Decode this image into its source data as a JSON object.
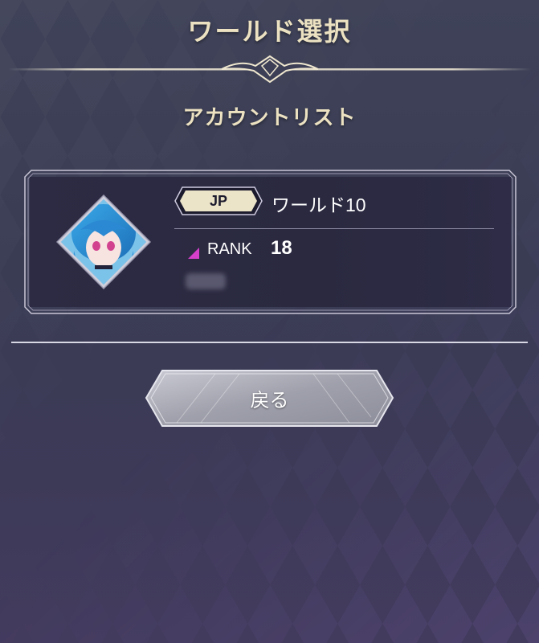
{
  "header": {
    "title": "ワールド選択",
    "subtitle": "アカウントリスト"
  },
  "account_card": {
    "region": "JP",
    "world_name": "ワールド10",
    "rank_label": "RANK",
    "rank_value": "18",
    "avatar_icon": "character-portrait-icon"
  },
  "actions": {
    "back_label": "戻る"
  },
  "colors": {
    "title_text": "#ece2c2",
    "background": "#3d3f56",
    "card_background": "#2c2b43",
    "rank_icon": "#d53fc9",
    "accent_gold": "#e8d9a8"
  }
}
